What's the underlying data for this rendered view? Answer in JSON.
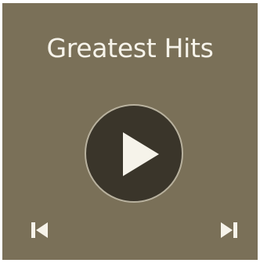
{
  "album": {
    "title": "Greatest Hits"
  },
  "controls": {
    "play_icon": "play-icon",
    "prev_icon": "skip-previous-icon",
    "next_icon": "skip-next-icon"
  },
  "colors": {
    "background": "#7a7058",
    "button_fill": "#3a352a",
    "button_ring": "#b8b19e",
    "foreground": "#f6f3ea"
  }
}
